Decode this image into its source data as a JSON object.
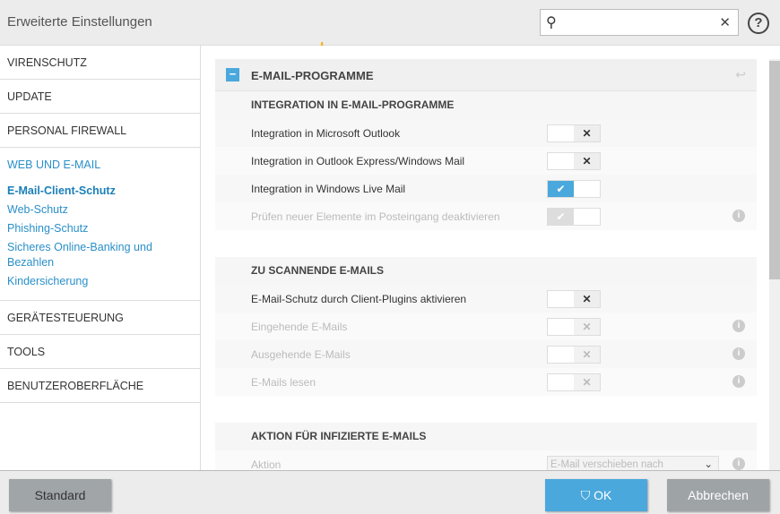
{
  "header": {
    "title": "Erweiterte Einstellungen",
    "search_placeholder": "",
    "help": "?"
  },
  "sidebar": {
    "items": [
      "VIRENSCHUTZ",
      "UPDATE",
      "PERSONAL FIREWALL",
      "WEB UND E-MAIL"
    ],
    "subitems": [
      "E-Mail-Client-Schutz",
      "Web-Schutz",
      "Phishing-Schutz",
      "Sicheres Online-Banking und Bezahlen",
      "Kindersicherung"
    ],
    "items_after": [
      "GERÄTESTEUERUNG",
      "TOOLS",
      "BENUTZEROBERFLÄCHE"
    ]
  },
  "panel": {
    "title": "E-MAIL-PROGRAMME",
    "sections": [
      {
        "title": "INTEGRATION IN E-MAIL-PROGRAMME",
        "rows": [
          {
            "label": "Integration in Microsoft Outlook",
            "on": false,
            "disabled": false
          },
          {
            "label": "Integration in Outlook Express/Windows Mail",
            "on": false,
            "disabled": false
          },
          {
            "label": "Integration in Windows Live Mail",
            "on": true,
            "disabled": false
          },
          {
            "label": "Prüfen neuer Elemente im Posteingang deaktivieren",
            "on": true,
            "disabled": true
          }
        ]
      },
      {
        "title": "ZU SCANNENDE E-MAILS",
        "rows": [
          {
            "label": "E-Mail-Schutz durch Client-Plugins aktivieren",
            "on": false,
            "disabled": false
          },
          {
            "label": "Eingehende E-Mails",
            "on": false,
            "disabled": true
          },
          {
            "label": "Ausgehende E-Mails",
            "on": false,
            "disabled": true
          },
          {
            "label": "E-Mails lesen",
            "on": false,
            "disabled": true
          }
        ]
      },
      {
        "title": "AKTION FÜR INFIZIERTE E-MAILS",
        "action_label": "Aktion",
        "action_value": "E-Mail verschieben nach"
      }
    ]
  },
  "footer": {
    "standard": "Standard",
    "ok": "OK",
    "cancel": "Abbrechen"
  },
  "colors": {
    "accent": "#4aa8dc"
  }
}
